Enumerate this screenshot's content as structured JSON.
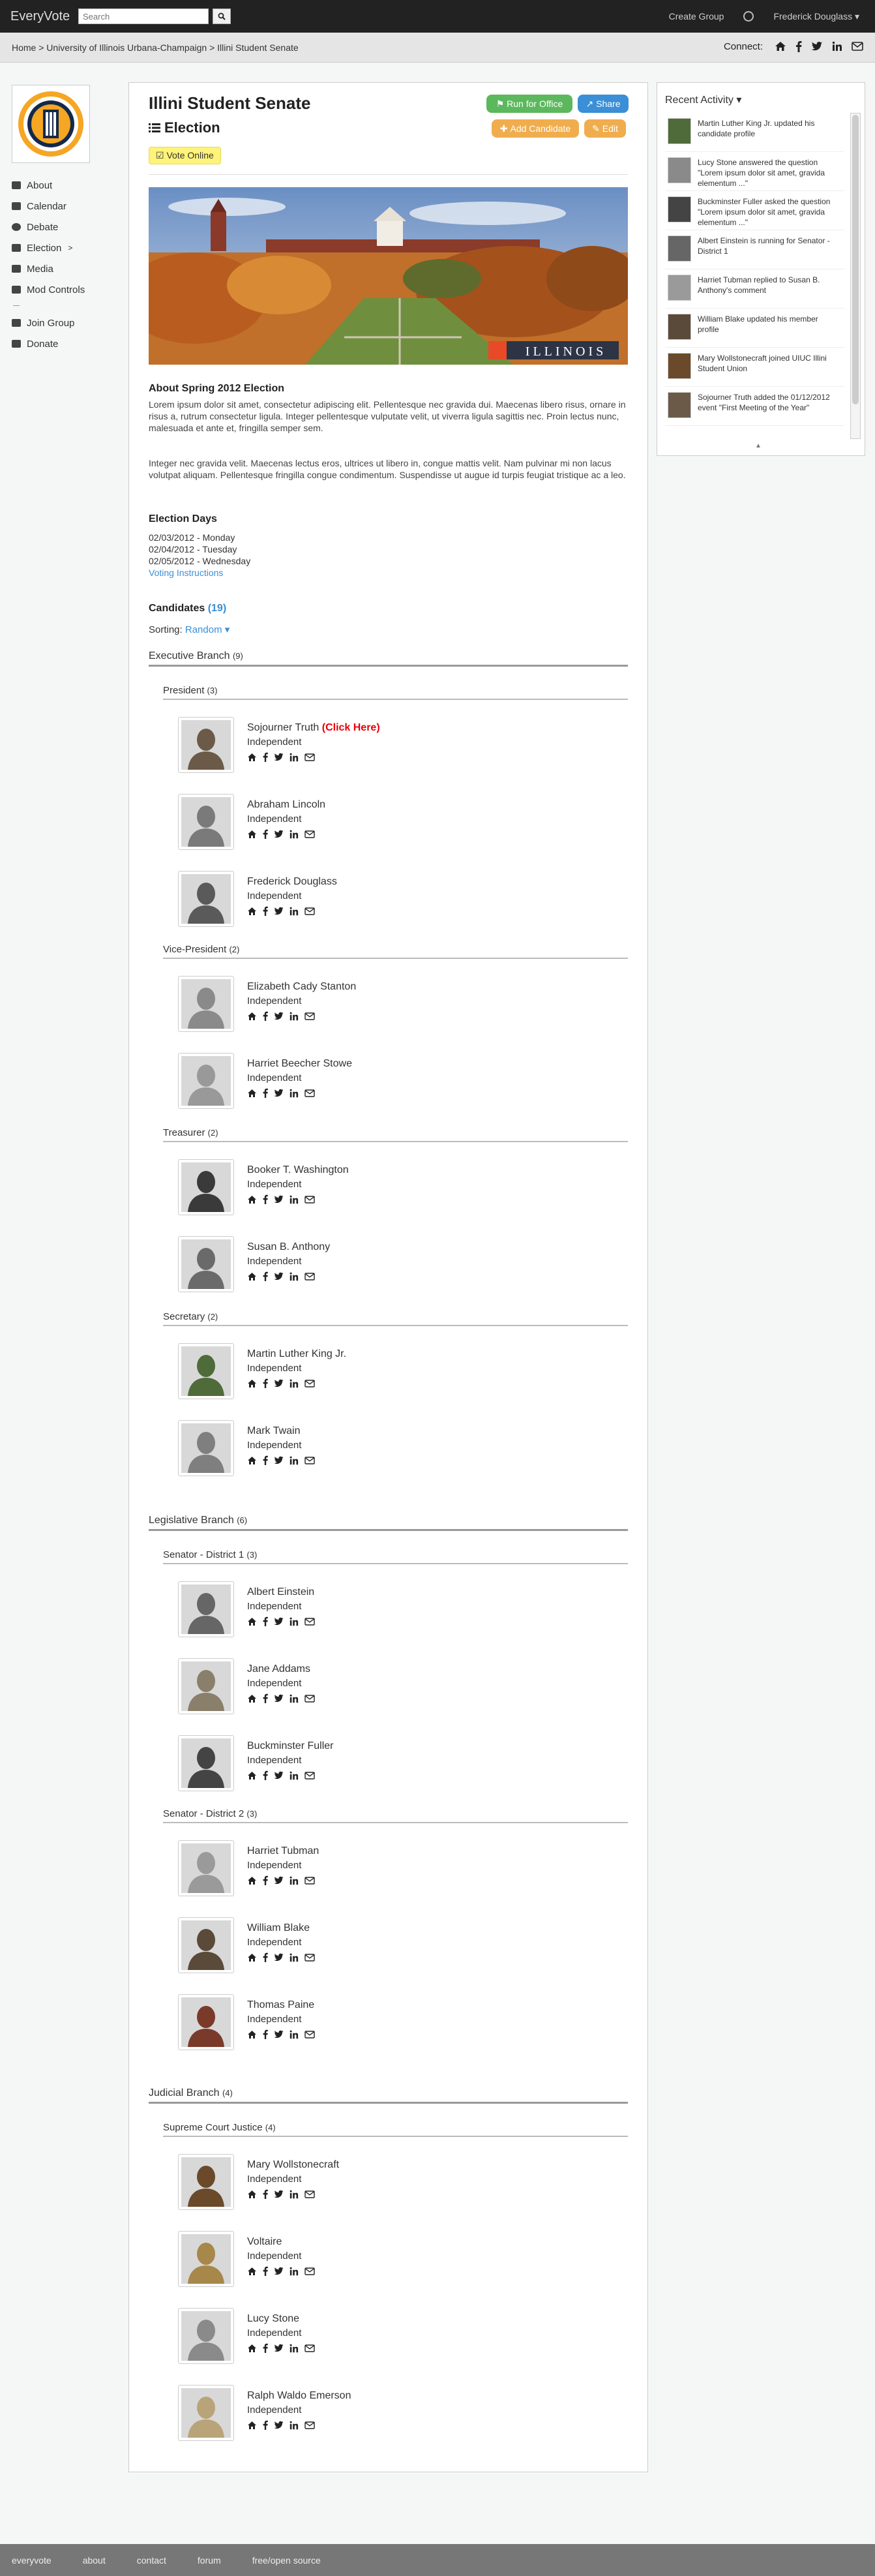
{
  "nav": {
    "brand": "EveryVote",
    "search_placeholder": "Search",
    "create_group": "Create Group",
    "user": "Frederick Douglass ▾"
  },
  "breadcrumb": "Home > University of Illinois Urbana-Champaign > Illini Student Senate",
  "connect_label": "Connect:",
  "sidebar": {
    "items": [
      {
        "label": "About",
        "icon": "book-icon"
      },
      {
        "label": "Calendar",
        "icon": "calendar-icon"
      },
      {
        "label": "Debate",
        "icon": "comments-icon"
      },
      {
        "label": "Election",
        "icon": "list-icon"
      },
      {
        "label": "Media",
        "icon": "film-icon"
      },
      {
        "label": "Mod Controls",
        "icon": "cogs-icon"
      }
    ],
    "join": "Join Group",
    "donate": "Donate"
  },
  "page": {
    "org": "Illini Student Senate",
    "election": "Election",
    "vote_online": "Vote Online",
    "run": "Run for Office",
    "share": "Share",
    "add_candidate": "Add Candidate",
    "edit": "Edit",
    "banner_text": "ILLINOIS",
    "about_heading": "About Spring 2012 Election",
    "para1": "Lorem ipsum dolor sit amet, consectetur adipiscing elit. Pellentesque nec gravida dui. Maecenas libero risus, ornare in risus a, rutrum consectetur ligula. Integer pellentesque vulputate velit, ut viverra ligula sagittis nec. Proin lectus nunc, malesuada et ante et, fringilla semper sem.",
    "para2": "Integer nec gravida velit. Maecenas lectus eros, ultrices ut libero in, congue mattis velit. Nam pulvinar mi non lacus volutpat aliquam. Pellentesque fringilla congue condimentum. Suspendisse ut augue id turpis feugiat tristique ac a leo.",
    "days_heading": "Election Days",
    "days": [
      "02/03/2012 - Monday",
      "02/04/2012 - Tuesday",
      "02/05/2012 - Wednesday"
    ],
    "voting_instructions": "Voting Instructions",
    "candidates_heading": "Candidates",
    "candidates_count": "(19)",
    "sorting_label": "Sorting:",
    "sorting_value": "Random"
  },
  "branches": {
    "executive": {
      "name": "Executive Branch",
      "count": "(9)"
    },
    "legislative": {
      "name": "Legislative Branch",
      "count": "(6)"
    },
    "judicial": {
      "name": "Judicial Branch",
      "count": "(4)"
    }
  },
  "offices": {
    "president": {
      "name": "President",
      "count": "(3)"
    },
    "vp": {
      "name": "Vice-President",
      "count": "(2)"
    },
    "treasurer": {
      "name": "Treasurer",
      "count": "(2)"
    },
    "secretary": {
      "name": "Secretary",
      "count": "(2)"
    },
    "sen1": {
      "name": "Senator - District 1",
      "count": "(3)"
    },
    "sen2": {
      "name": "Senator - District 2",
      "count": "(3)"
    },
    "scj": {
      "name": "Supreme Court Justice",
      "count": "(4)"
    }
  },
  "click_here": "(Click Here)",
  "party": "Independent",
  "candidates": [
    {
      "name": "Sojourner Truth"
    },
    {
      "name": "Abraham Lincoln"
    },
    {
      "name": "Frederick Douglass"
    },
    {
      "name": "Elizabeth Cady Stanton"
    },
    {
      "name": "Harriet Beecher Stowe"
    },
    {
      "name": "Booker T. Washington"
    },
    {
      "name": "Susan B. Anthony"
    },
    {
      "name": "Martin Luther King Jr."
    },
    {
      "name": "Mark Twain"
    },
    {
      "name": "Albert Einstein"
    },
    {
      "name": "Jane Addams"
    },
    {
      "name": "Buckminster Fuller"
    },
    {
      "name": "Harriet Tubman"
    },
    {
      "name": "William Blake"
    },
    {
      "name": "Thomas Paine"
    },
    {
      "name": "Mary Wollstonecraft"
    },
    {
      "name": "Voltaire"
    },
    {
      "name": "Lucy Stone"
    },
    {
      "name": "Ralph Waldo Emerson"
    }
  ],
  "recent": {
    "heading": "Recent Activity ▾",
    "items": [
      "Martin Luther King Jr. updated his candidate profile",
      "Lucy Stone answered the question \"Lorem ipsum dolor sit amet, gravida elementum ...\"",
      "Buckminster Fuller asked the question \"Lorem ipsum dolor sit amet, gravida elementum ...\"",
      "Albert Einstein is running for Senator - District 1",
      "Harriet Tubman replied to Susan B. Anthony's comment",
      "William Blake updated his member profile",
      "Mary Wollstonecraft joined UIUC Illini Student Union",
      "Sojourner Truth added the 01/12/2012 event \"First Meeting of the Year\""
    ]
  },
  "footer": [
    "everyvote",
    "about",
    "contact",
    "forum",
    "free/open source"
  ],
  "colors": {
    "run": "#5cb85c",
    "share": "#3a8fd6",
    "warning": "#f0ad4e",
    "vote": "#fff37a",
    "click_here": "#e8000b"
  }
}
